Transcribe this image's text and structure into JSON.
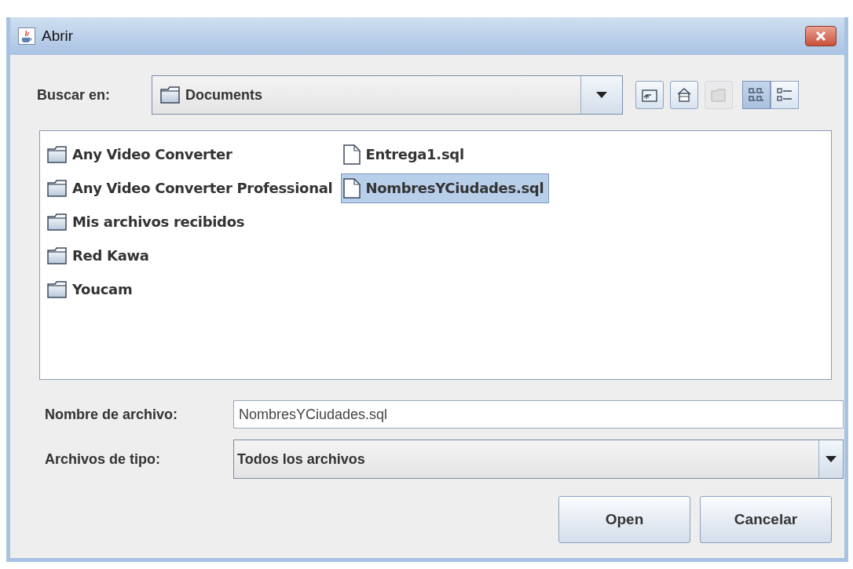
{
  "window": {
    "title": "Abrir"
  },
  "look_in": {
    "label": "Buscar en:",
    "value": "Documents"
  },
  "toolbar": [
    {
      "kind": "up",
      "disabled": false,
      "selected": false
    },
    {
      "kind": "home",
      "disabled": false,
      "selected": false
    },
    {
      "kind": "new-folder",
      "disabled": true,
      "selected": false
    },
    {
      "kind": "list",
      "disabled": false,
      "selected": true
    },
    {
      "kind": "details",
      "disabled": false,
      "selected": false
    }
  ],
  "files": [
    {
      "name": "Any Video Converter",
      "kind": "folder",
      "selected": false
    },
    {
      "name": "Any Video Converter Professional",
      "kind": "folder",
      "selected": false
    },
    {
      "name": "Mis archivos recibidos",
      "kind": "folder",
      "selected": false
    },
    {
      "name": "Red Kawa",
      "kind": "folder",
      "selected": false
    },
    {
      "name": "Youcam",
      "kind": "folder",
      "selected": false
    },
    {
      "name": "Entrega1.sql",
      "kind": "file",
      "selected": false
    },
    {
      "name": "NombresYCiudades.sql",
      "kind": "file",
      "selected": true
    }
  ],
  "file_name": {
    "label": "Nombre de archivo:",
    "value": "NombresYCiudades.sql"
  },
  "file_type": {
    "label": "Archivos de tipo:",
    "value": "Todos los archivos"
  },
  "buttons": [
    "Open",
    "Cancelar"
  ]
}
